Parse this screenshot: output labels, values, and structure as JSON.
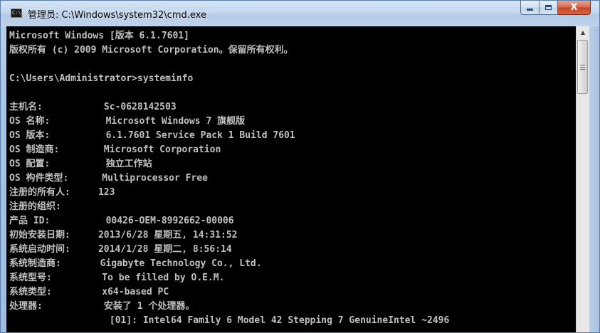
{
  "window": {
    "title": "管理员: C:\\Windows\\system32\\cmd.exe",
    "icon": "cmd-app-icon",
    "icon_glyph": "C:\\",
    "close_glyph": "X",
    "colors": {
      "console_background": "#000000",
      "console_text": "#c0c0c0",
      "close_button": "#c44326"
    }
  },
  "console": {
    "lines": [
      "Microsoft Windows [版本 6.1.7601]",
      "版权所有 (c) 2009 Microsoft Corporation。保留所有权利。",
      "",
      "C:\\Users\\Administrator>systeminfo",
      "",
      "主机名:           Sc-0628142503",
      "OS 名称:          Microsoft Windows 7 旗舰版",
      "OS 版本:          6.1.7601 Service Pack 1 Build 7601",
      "OS 制造商:        Microsoft Corporation",
      "OS 配置:          独立工作站",
      "OS 构件类型:      Multiprocessor Free",
      "注册的所有人:     123",
      "注册的组织:",
      "产品 ID:          00426-OEM-8992662-00006",
      "初始安装日期:     2013/6/28 星期五, 14:31:52",
      "系统启动时间:     2014/1/28 星期二, 8:56:14",
      "系统制造商:       Gigabyte Technology Co., Ltd.",
      "系统型号:         To be filled by O.E.M.",
      "系统类型:         x64-based PC",
      "处理器:           安装了 1 个处理器。",
      "                  [01]: Intel64 Family 6 Model 42 Stepping 7 GenuineIntel ~2496"
    ]
  },
  "scrollbar": {
    "up_arrow": "▲"
  }
}
